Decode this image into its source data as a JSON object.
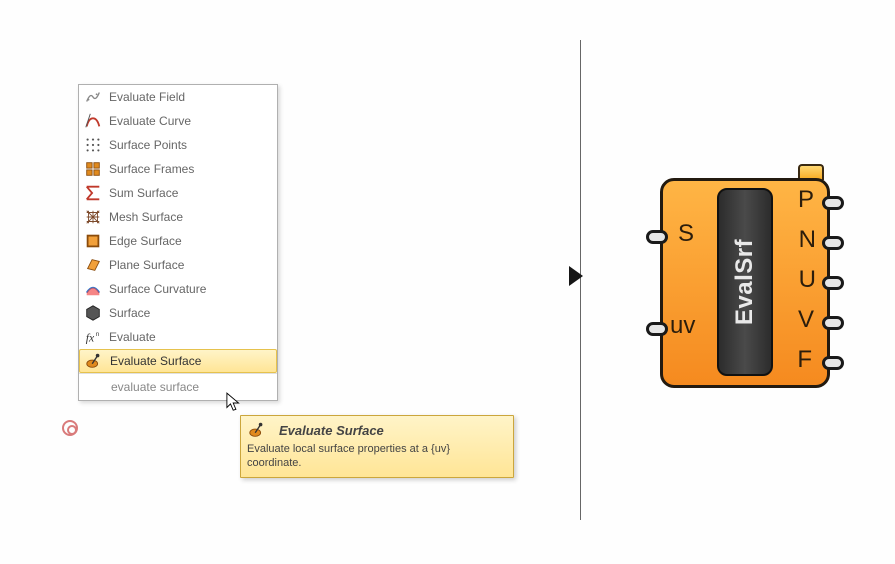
{
  "menu": {
    "items": [
      {
        "label": "Evaluate Field",
        "icon": "field"
      },
      {
        "label": "Evaluate Curve",
        "icon": "curve"
      },
      {
        "label": "Surface Points",
        "icon": "points"
      },
      {
        "label": "Surface Frames",
        "icon": "frames"
      },
      {
        "label": "Sum Surface",
        "icon": "sum"
      },
      {
        "label": "Mesh Surface",
        "icon": "mesh"
      },
      {
        "label": "Edge Surface",
        "icon": "edge"
      },
      {
        "label": "Plane Surface",
        "icon": "plane"
      },
      {
        "label": "Surface Curvature",
        "icon": "curvature"
      },
      {
        "label": "Surface",
        "icon": "surface"
      },
      {
        "label": "Evaluate",
        "icon": "fx"
      },
      {
        "label": "Evaluate Surface",
        "icon": "evalsrf",
        "selected": true
      }
    ],
    "search_value": "evaluate surface"
  },
  "tooltip": {
    "title": "Evaluate Surface",
    "description": "Evaluate local surface properties at a {uv} coordinate."
  },
  "component": {
    "name": "EvalSrf",
    "inputs": [
      "S",
      "uv"
    ],
    "outputs": [
      "P",
      "N",
      "U",
      "V",
      "F"
    ]
  }
}
